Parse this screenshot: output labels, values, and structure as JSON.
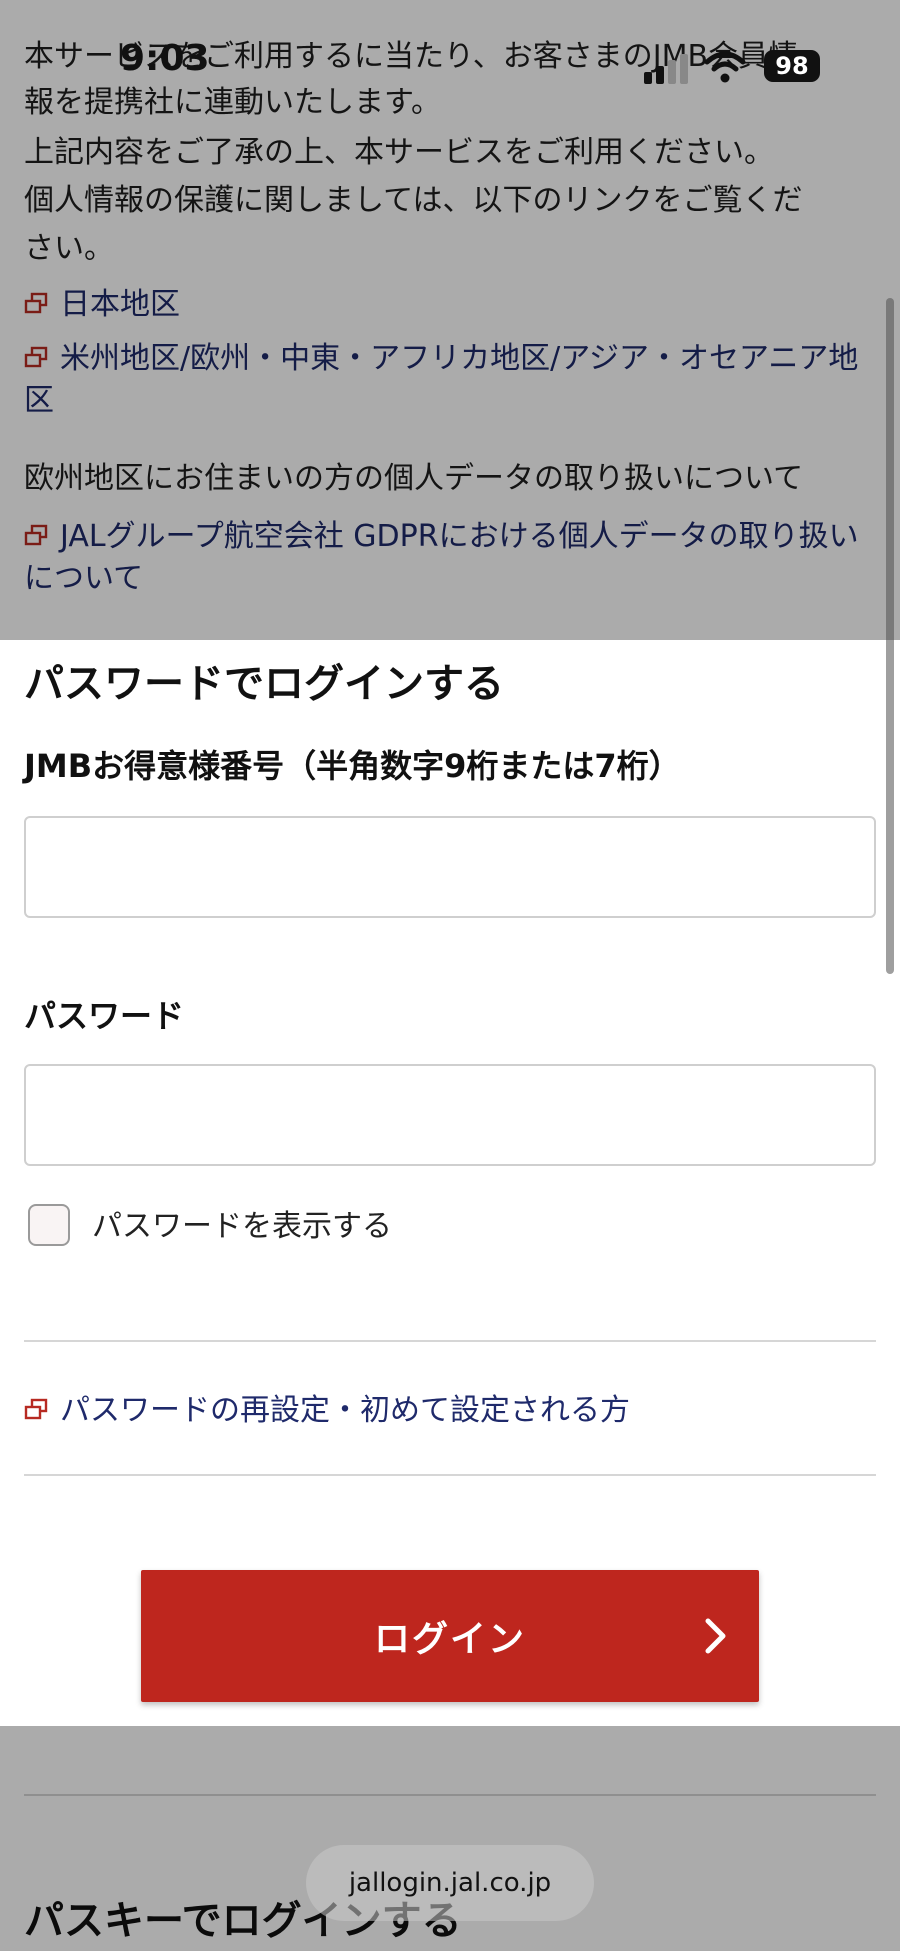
{
  "status_bar": {
    "time": "9:03",
    "battery": "98"
  },
  "notice": {
    "line1": "本サービスをご利用するに当たり、お客さまのJMB会員情",
    "line2": "報を提携社に連動いたします。",
    "line3": "上記内容をご了承の上、本サービスをご利用ください。",
    "line4": "個人情報の保護に関しましては、以下のリンクをご覧くだ",
    "line5": "さい。"
  },
  "privacy_links": {
    "japan": "日本地区",
    "overseas": "米州地区/欧州・中東・アフリカ地区/アジア・オセアニア地区",
    "eu_heading": "欧州地区にお住まいの方の個人データの取り扱いについて",
    "gdpr": "JALグループ航空会社 GDPRにおける個人データの取り扱いについて"
  },
  "login": {
    "title": "パスワードでログインする",
    "member_label": "JMBお得意様番号（半角数字9桁または7桁）",
    "member_value": "",
    "password_label": "パスワード",
    "password_value": "",
    "show_password_label": "パスワードを表示する",
    "show_password_checked": false,
    "reset_link": "パスワードの再設定・初めて設定される方",
    "login_button": "ログイン"
  },
  "passkey": {
    "title": "パスキーでログインする"
  },
  "browser": {
    "url": "jallogin.jal.co.jp"
  },
  "colors": {
    "accent_red": "#be261e",
    "link_navy": "#1f2a6b"
  },
  "icons": {
    "external_link": "external-link-icon",
    "chevron": "chevron-right-icon",
    "wifi": "wifi-icon",
    "signal": "signal-icon"
  }
}
